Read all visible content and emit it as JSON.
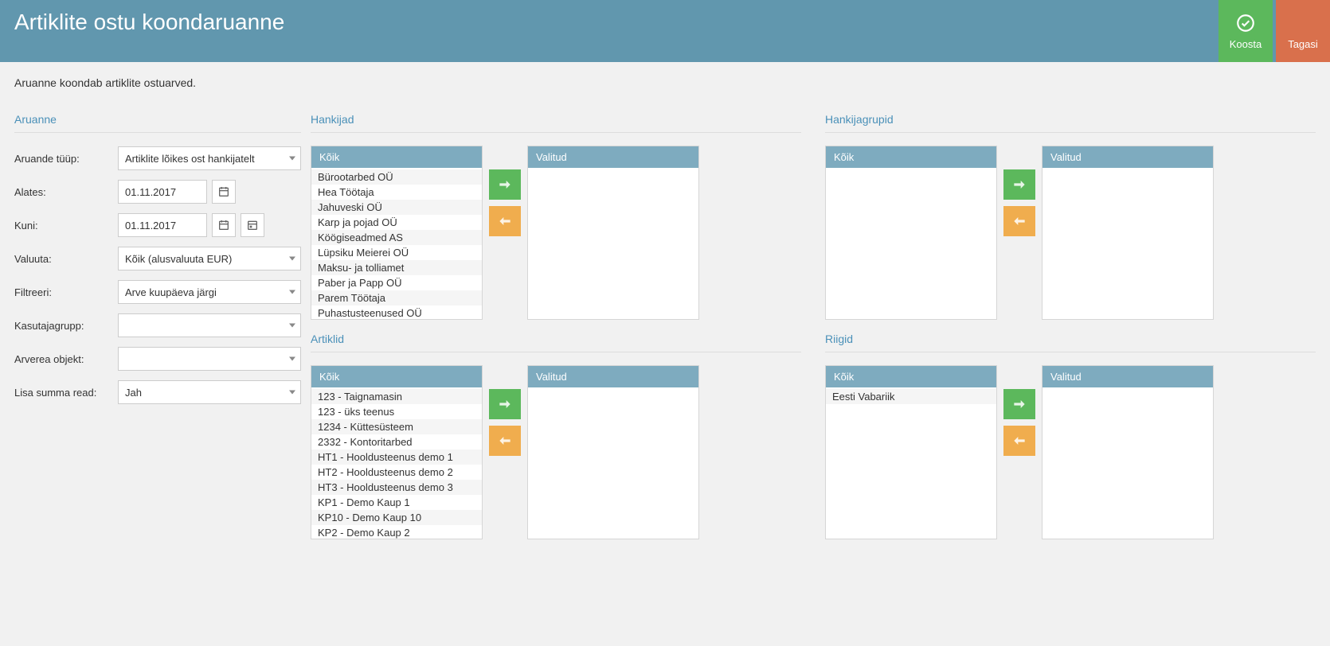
{
  "header": {
    "title": "Artiklite ostu koondaruanne",
    "compose": "Koosta",
    "back": "Tagasi"
  },
  "description": "Aruanne koondab artiklite ostuarved.",
  "form": {
    "title": "Aruanne",
    "fields": {
      "report_type_label": "Aruande tüüp:",
      "report_type_value": "Artiklite lõikes ost hankijatelt",
      "from_label": "Alates:",
      "from_value": "01.11.2017",
      "to_label": "Kuni:",
      "to_value": "01.11.2017",
      "currency_label": "Valuuta:",
      "currency_value": "Kõik (alusvaluuta EUR)",
      "filter_label": "Filtreeri:",
      "filter_value": "Arve kuupäeva järgi",
      "usergroup_label": "Kasutajagrupp:",
      "usergroup_value": "",
      "lineobject_label": "Arverea objekt:",
      "lineobject_value": "",
      "addsum_label": "Lisa summa read:",
      "addsum_value": "Jah"
    }
  },
  "pickers": {
    "all_header": "Kõik",
    "selected_header": "Valitud",
    "suppliers": {
      "title": "Hankijad",
      "items": [
        "Bürootarbed OÜ",
        "Hea Töötaja",
        "Jahuveski OÜ",
        "Karp ja pojad OÜ",
        "Köögiseadmed AS",
        "Lüpsiku Meierei OÜ",
        "Maksu- ja tolliamet",
        "Paber ja Papp OÜ",
        "Parem Töötaja",
        "Puhastusteenused OÜ"
      ]
    },
    "supplier_groups": {
      "title": "Hankijagrupid",
      "items": []
    },
    "articles": {
      "title": "Artiklid",
      "items": [
        "123 - Taignamasin",
        "123 - üks teenus",
        "1234 - Küttesüsteem",
        "2332 - Kontoritarbed",
        "HT1 - Hooldusteenus demo 1",
        "HT2 - Hooldusteenus demo 2",
        "HT3 - Hooldusteenus demo 3",
        "KP1 - Demo Kaup 1",
        "KP10 - Demo Kaup 10",
        "KP2 - Demo Kaup 2"
      ]
    },
    "countries": {
      "title": "Riigid",
      "items": [
        "Eesti Vabariik"
      ]
    }
  }
}
